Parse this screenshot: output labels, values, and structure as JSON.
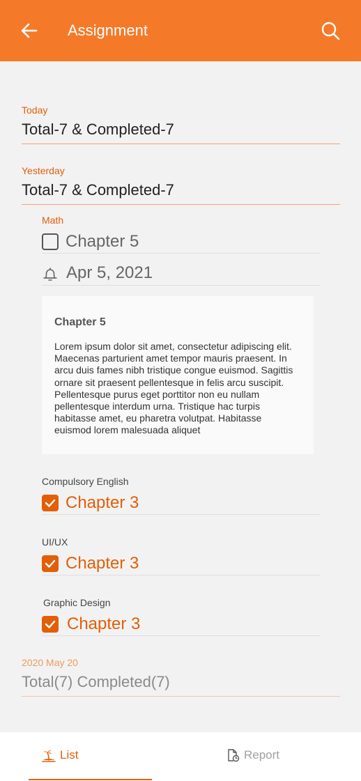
{
  "header": {
    "title": "Assignment"
  },
  "groups": [
    {
      "date": "Today",
      "summary": "Total-7 & Completed-7"
    },
    {
      "date": "Yesterday",
      "summary": "Total-7 & Completed-7"
    },
    {
      "date": "2020 May 20",
      "summary": "Total(7) Completed(7)"
    }
  ],
  "yesterday_tasks": [
    {
      "subject": "Math",
      "task": "Chapter 5",
      "completed": false
    },
    {
      "subject": "Compulsory English",
      "task": "Chapter 3",
      "completed": true
    },
    {
      "subject": "UI/UX",
      "task": "Chapter 3",
      "completed": true
    },
    {
      "subject": "Graphic Design",
      "task": "Chapter 3",
      "completed": true
    }
  ],
  "reminder": {
    "date": "Apr 5, 2021"
  },
  "note": {
    "title": "Chapter 5",
    "body": "Lorem ipsum dolor sit amet, consectetur adipiscing elit. Maecenas parturient amet tempor mauris praesent. In arcu duis fames nibh tristique congue euismod. Sagittis ornare sit praesent pellentesque in felis arcu suscipit. Pellentesque purus eget porttitor non eu nullam pellentesque interdum urna. Tristique hac turpis habitasse amet, eu pharetra volutpat. Habitasse euismod lorem malesuada aliquet"
  },
  "bottom_nav": [
    {
      "label": "List",
      "icon": "island-icon",
      "active": true
    },
    {
      "label": "Report",
      "icon": "report-clock-icon",
      "active": false
    }
  ],
  "colors": {
    "primary": "#f47a2a",
    "accent": "#e25f07",
    "background": "#f2f2f2"
  }
}
